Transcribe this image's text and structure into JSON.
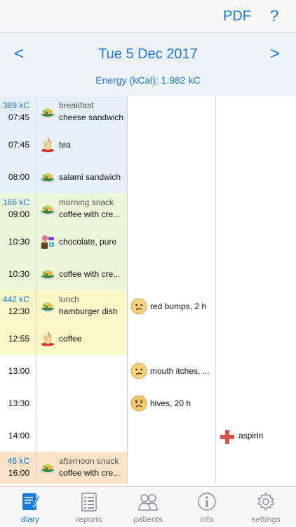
{
  "header": {
    "pdf_label": "PDF",
    "help_label": "?"
  },
  "datebar": {
    "prev_label": "<",
    "next_label": ">",
    "date": "Tue 5 Dec 2017",
    "energy": "Energy (kCal): 1.982 kC"
  },
  "colors": {
    "accent": "#1a7ae0",
    "breakfast": "#e6f1fb",
    "morning_snack": "#eaf7d8",
    "lunch": "#fdf8c8",
    "afternoon_snack": "#fde3c8",
    "plain": "#ffffff"
  },
  "rows": [
    {
      "kc": "389 kC",
      "time": "07:45",
      "bg": "breakfast",
      "food_icon": "salad-icon",
      "category": "breakfast",
      "food": "cheese sandwich",
      "symptom_icon": "",
      "symptom": "",
      "medication_icon": "",
      "medication": ""
    },
    {
      "kc": "",
      "time": "07:45",
      "bg": "breakfast",
      "food_icon": "drink-icon",
      "category": "",
      "food": "tea",
      "symptom_icon": "",
      "symptom": "",
      "medication_icon": "",
      "medication": ""
    },
    {
      "kc": "",
      "time": "08:00",
      "bg": "breakfast",
      "food_icon": "salad-icon",
      "category": "",
      "food": "salami sandwich",
      "symptom_icon": "",
      "symptom": "",
      "medication_icon": "",
      "medication": ""
    },
    {
      "kc": "166 kC",
      "time": "09:00",
      "bg": "morning_snack",
      "food_icon": "salad-icon",
      "category": "morning snack",
      "food": "coffee with cre...",
      "symptom_icon": "",
      "symptom": "",
      "medication_icon": "",
      "medication": ""
    },
    {
      "kc": "",
      "time": "10:30",
      "bg": "morning_snack",
      "food_icon": "sweets-icon",
      "category": "",
      "food": "chocolate, pure",
      "symptom_icon": "",
      "symptom": "",
      "medication_icon": "",
      "medication": ""
    },
    {
      "kc": "",
      "time": "10:30",
      "bg": "morning_snack",
      "food_icon": "salad-icon",
      "category": "",
      "food": "coffee with cre...",
      "symptom_icon": "",
      "symptom": "",
      "medication_icon": "",
      "medication": ""
    },
    {
      "kc": "442 kC",
      "time": "12:30",
      "bg": "lunch",
      "food_icon": "salad-icon",
      "category": "lunch",
      "food": "hamburger dish",
      "symptom_icon": "confused-face-icon",
      "symptom": "red bumps, 2 h",
      "medication_icon": "",
      "medication": ""
    },
    {
      "kc": "",
      "time": "12:55",
      "bg": "lunch",
      "food_icon": "drink-icon",
      "category": "",
      "food": "coffee",
      "symptom_icon": "",
      "symptom": "",
      "medication_icon": "",
      "medication": ""
    },
    {
      "kc": "",
      "time": "13:00",
      "bg": "plain",
      "food_icon": "",
      "category": "",
      "food": "",
      "symptom_icon": "confused-face-icon",
      "symptom": "mouth itches, ...",
      "medication_icon": "",
      "medication": ""
    },
    {
      "kc": "",
      "time": "13:30",
      "bg": "plain",
      "food_icon": "",
      "category": "",
      "food": "",
      "symptom_icon": "worried-face-icon",
      "symptom": "hives, 20 h",
      "medication_icon": "",
      "medication": ""
    },
    {
      "kc": "",
      "time": "14:00",
      "bg": "plain",
      "food_icon": "",
      "category": "",
      "food": "",
      "symptom_icon": "",
      "symptom": "",
      "medication_icon": "red-cross-icon",
      "medication": "aspirin"
    },
    {
      "kc": "46 kC",
      "time": "16:00",
      "bg": "afternoon_snack",
      "food_icon": "salad-icon",
      "category": "afternoon snack",
      "food": "coffee with cre...",
      "symptom_icon": "",
      "symptom": "",
      "medication_icon": "",
      "medication": ""
    }
  ],
  "tabs": [
    {
      "label": "diary",
      "icon": "diary-icon",
      "active": true
    },
    {
      "label": "reports",
      "icon": "reports-icon",
      "active": false
    },
    {
      "label": "patients",
      "icon": "patients-icon",
      "active": false
    },
    {
      "label": "info",
      "icon": "info-icon",
      "active": false
    },
    {
      "label": "settings",
      "icon": "settings-icon",
      "active": false
    }
  ]
}
